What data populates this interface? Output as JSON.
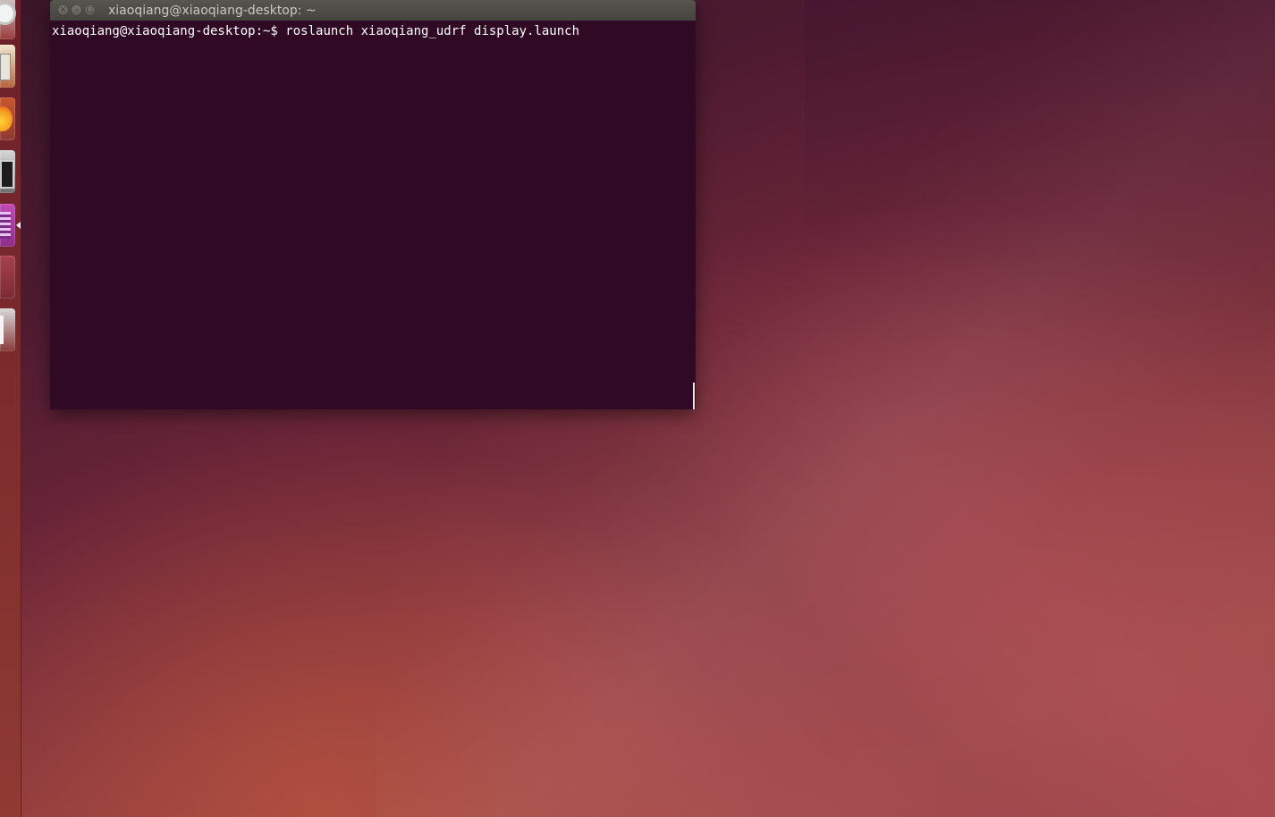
{
  "desktop": {
    "launcher": {
      "items": [
        {
          "icon": "ubuntu-logo-icon"
        },
        {
          "icon": "files-icon"
        },
        {
          "icon": "firefox-icon"
        },
        {
          "icon": "terminal-app-icon"
        },
        {
          "icon": "calculator-icon"
        },
        {
          "icon": "app-icon"
        },
        {
          "icon": "text-editor-icon"
        }
      ]
    }
  },
  "terminal": {
    "title": "xiaoqiang@xiaoqiang-desktop: ~",
    "buttons": {
      "close": "×",
      "minimize": "–",
      "maximize": "□"
    },
    "prompt": "xiaoqiang@xiaoqiang-desktop:~$ ",
    "command": "roslaunch xiaoqiang_udrf display.launch"
  }
}
